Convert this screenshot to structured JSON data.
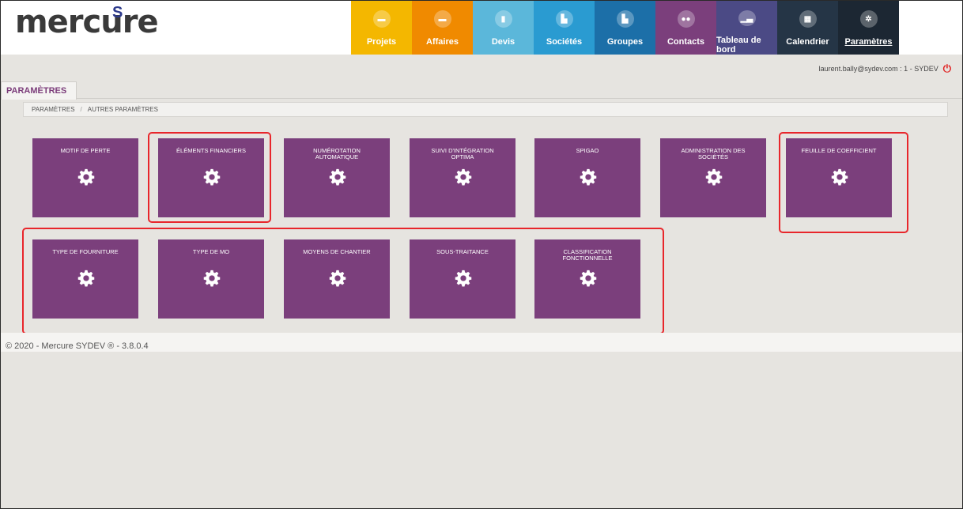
{
  "header": {
    "logo_text": "mercure",
    "logo_badge": "S",
    "nav": [
      {
        "label": "Projets",
        "color": "#f4b700",
        "icon": "folder-icon"
      },
      {
        "label": "Affaires",
        "color": "#f08a00",
        "icon": "folder-icon"
      },
      {
        "label": "Devis",
        "color": "#5bb7da",
        "icon": "document-icon"
      },
      {
        "label": "Sociétés",
        "color": "#2a9bd1",
        "icon": "factory-icon"
      },
      {
        "label": "Groupes",
        "color": "#1c6fa8",
        "icon": "factory-icon"
      },
      {
        "label": "Contacts",
        "color": "#7b3f7c",
        "icon": "people-icon"
      },
      {
        "label": "Tableau de bord",
        "color": "#4b4a85",
        "icon": "chart-icon"
      },
      {
        "label": "Calendrier",
        "color": "#253546",
        "icon": "calendar-icon"
      },
      {
        "label": "Paramètres",
        "color": "#1c2733",
        "icon": "settings-icon"
      }
    ]
  },
  "user": {
    "info": "laurent.bally@sydev.com : 1 - SYDEV"
  },
  "page": {
    "tab_label": "PARAMÈTRES",
    "breadcrumb": [
      "PARAMÈTRES",
      "AUTRES PARAMÈTRES"
    ],
    "breadcrumb_sep": "/"
  },
  "tiles_row1": [
    "MOTIF DE PERTE",
    "ÉLÉMENTS FINANCIERS",
    "NUMÉROTATION AUTOMATIQUE",
    "SUIVI D'INTÉGRATION OPTIMA",
    "SPIGAO",
    "ADMINISTRATION DES SOCIÉTÉS",
    "FEUILLE DE COEFFICIENT"
  ],
  "tiles_row2": [
    "TYPE DE FOURNITURE",
    "TYPE DE MO",
    "MOYENS DE CHANTIER",
    "SOUS-TRAITANCE",
    "CLASSIFICATION FONCTIONNELLE"
  ],
  "tile_color": "#7b3f7c",
  "highlight_color": "#e8262b",
  "footer": {
    "text": "© 2020 - Mercure SYDEV ® - 3.8.0.4"
  }
}
